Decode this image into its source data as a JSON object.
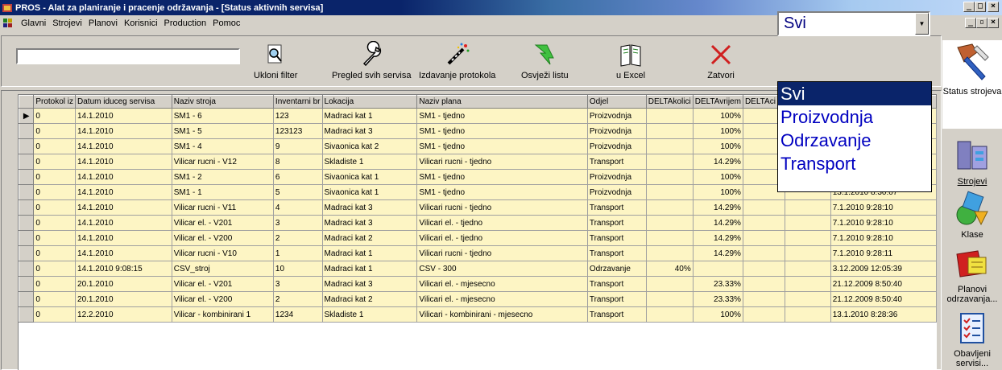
{
  "window": {
    "title": "PROS - Alat za planiranje i pracenje održavanja - [Status aktivnih servisa]",
    "min": "_",
    "max": "□",
    "close": "×",
    "mdi_min": "_",
    "mdi_restore": "▫",
    "mdi_close": "×"
  },
  "menu": [
    "Glavni",
    "Strojevi",
    "Planovi",
    "Korisnici",
    "Production",
    "Pomoc"
  ],
  "toolbar": {
    "filter_value": "",
    "buttons": {
      "ukloni": "Ukloni filter",
      "pregled": "Pregled svih servisa",
      "izdavanje": "Izdavanje protokola",
      "osvjezi": "Osvježi listu",
      "excel": "u Excel",
      "zatvori": "Zatvori"
    },
    "combo_value": "Svi"
  },
  "dropdown": [
    "Svi",
    "Proizvodnja",
    "Odrzavanje",
    "Transport"
  ],
  "grid": {
    "columns": [
      "Protokol iz",
      "Datum iduceg servisa",
      "Naziv stroja",
      "Inventarni br",
      "Lokacija",
      "Naziv plana",
      "Odjel",
      "DELTAkolici",
      "DELTAvrijem",
      "DELTAci",
      "",
      ""
    ],
    "rows": [
      [
        "0",
        "14.1.2010",
        "SM1 - 6",
        "123",
        "Madraci kat 1",
        "SM1 - tjedno",
        "Proizvodnja",
        "",
        "100%",
        "",
        "",
        ""
      ],
      [
        "0",
        "14.1.2010",
        "SM1 - 5",
        "123123",
        "Madraci kat 3",
        "SM1 - tjedno",
        "Proizvodnja",
        "",
        "100%",
        "",
        "",
        ""
      ],
      [
        "0",
        "14.1.2010",
        "SM1 - 4",
        "9",
        "Sivaonica kat 2",
        "SM1 - tjedno",
        "Proizvodnja",
        "",
        "100%",
        "",
        "",
        ""
      ],
      [
        "0",
        "14.1.2010",
        "Vilicar rucni - V12",
        "8",
        "Skladiste 1",
        "Vilicari rucni - tjedno",
        "Transport",
        "",
        "14.29%",
        "",
        "",
        ""
      ],
      [
        "0",
        "14.1.2010",
        "SM1 - 2",
        "6",
        "Sivaonica kat 1",
        "SM1 - tjedno",
        "Proizvodnja",
        "",
        "100%",
        "",
        "",
        ""
      ],
      [
        "0",
        "14.1.2010",
        "SM1 - 1",
        "5",
        "Sivaonica kat 1",
        "SM1 - tjedno",
        "Proizvodnja",
        "",
        "100%",
        "",
        "",
        "13.1.2010 8:30:07"
      ],
      [
        "0",
        "14.1.2010",
        "Vilicar rucni - V11",
        "4",
        "Madraci kat 3",
        "Vilicari rucni - tjedno",
        "Transport",
        "",
        "14.29%",
        "",
        "",
        "7.1.2010 9:28:10"
      ],
      [
        "0",
        "14.1.2010",
        "Vilicar el. - V201",
        "3",
        "Madraci kat 3",
        "Vilicari el. - tjedno",
        "Transport",
        "",
        "14.29%",
        "",
        "",
        "7.1.2010 9:28:10"
      ],
      [
        "0",
        "14.1.2010",
        "Vilicar el. - V200",
        "2",
        "Madraci kat 2",
        "Vilicari el. - tjedno",
        "Transport",
        "",
        "14.29%",
        "",
        "",
        "7.1.2010 9:28:10"
      ],
      [
        "0",
        "14.1.2010",
        "Vilicar rucni - V10",
        "1",
        "Madraci kat 1",
        "Vilicari rucni - tjedno",
        "Transport",
        "",
        "14.29%",
        "",
        "",
        "7.1.2010 9:28:11"
      ],
      [
        "0",
        "14.1.2010 9:08:15",
        "CSV_stroj",
        "10",
        "Madraci kat 1",
        "CSV - 300",
        "Odrzavanje",
        "40%",
        "",
        "",
        "",
        "3.12.2009 12:05:39"
      ],
      [
        "0",
        "20.1.2010",
        "Vilicar el. - V201",
        "3",
        "Madraci kat 3",
        "Vilicari el. - mjesecno",
        "Transport",
        "",
        "23.33%",
        "",
        "",
        "21.12.2009 8:50:40"
      ],
      [
        "0",
        "20.1.2010",
        "Vilicar el. - V200",
        "2",
        "Madraci kat 2",
        "Vilicari el. - mjesecno",
        "Transport",
        "",
        "23.33%",
        "",
        "",
        "21.12.2009 8:50:40"
      ],
      [
        "0",
        "12.2.2010",
        "Vilicar - kombinirani 1",
        "1234",
        "Skladiste 1",
        "Vilicari - kombinirani - mjesecno",
        "Transport",
        "",
        "100%",
        "",
        "",
        "13.1.2010 8:28:36"
      ]
    ]
  },
  "sidebar": {
    "status": "Status strojeva",
    "strojevi": "Strojevi",
    "klase": "Klase",
    "planovi": "Planovi odrzavanja...",
    "obavljeni": "Obavljeni servisi..."
  },
  "colors": {
    "row_bg": "#fdf5c4",
    "title_bg": "#0a246a",
    "dropdown_text": "#0000c0"
  }
}
